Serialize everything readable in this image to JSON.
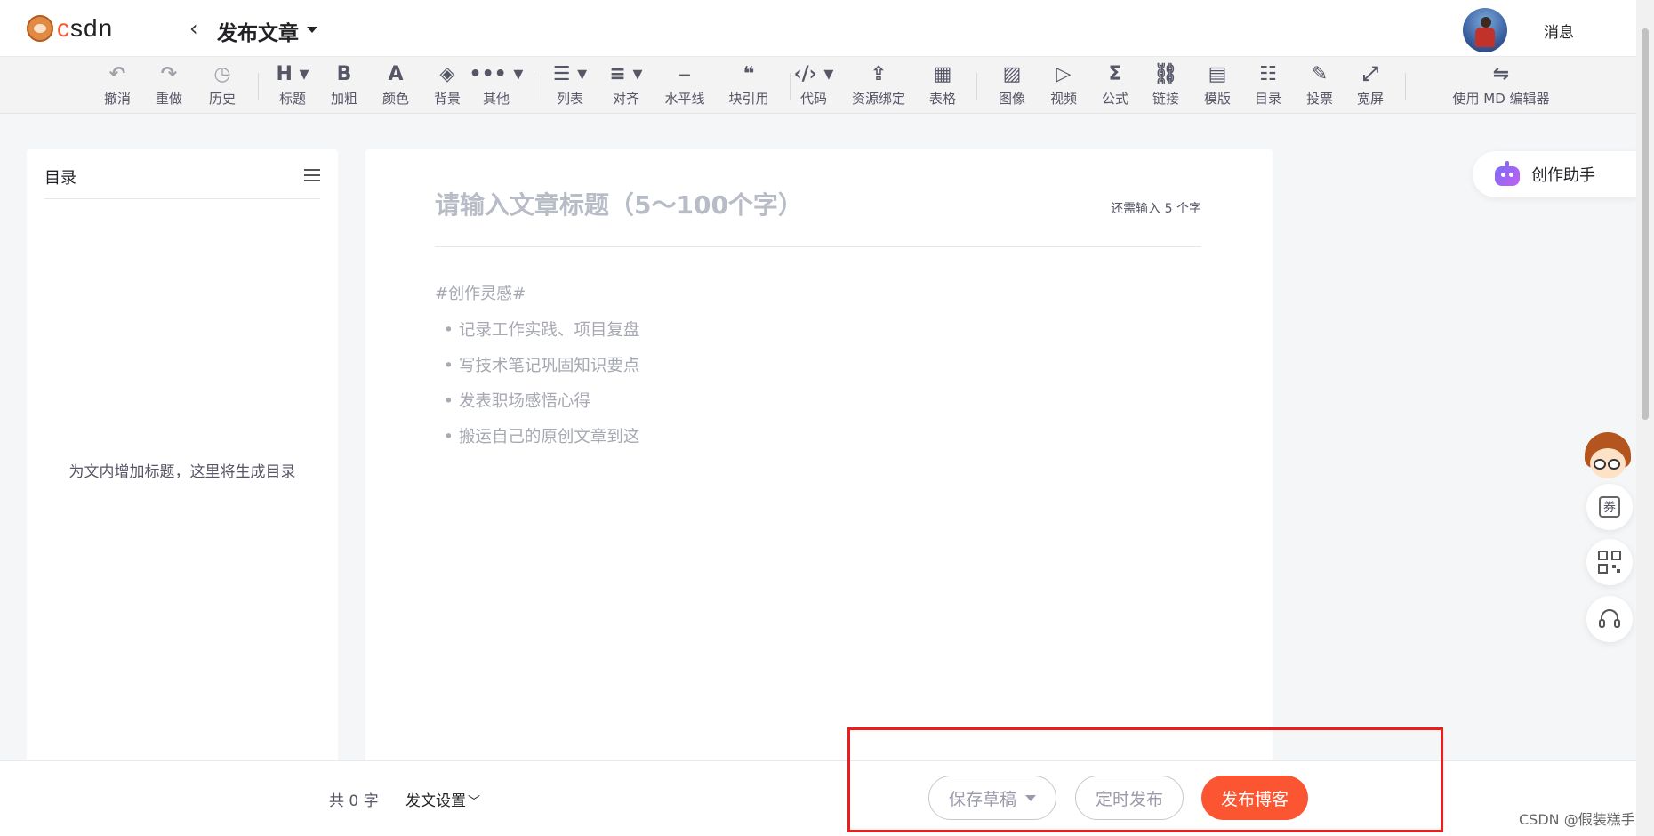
{
  "header": {
    "logo_text": "csdn",
    "back_icon": "chevron-left-icon",
    "title": "发布文章",
    "messages": "消息"
  },
  "toolbar": {
    "items": [
      {
        "icon": "↶",
        "label": "撤消",
        "name": "undo"
      },
      {
        "icon": "↷",
        "label": "重做",
        "name": "redo"
      },
      {
        "icon": "◷",
        "label": "历史",
        "name": "history"
      },
      {
        "icon": "H ▾",
        "label": "标题",
        "name": "heading"
      },
      {
        "icon": "B",
        "label": "加粗",
        "name": "bold"
      },
      {
        "icon": "A",
        "label": "颜色",
        "name": "color"
      },
      {
        "icon": "◈",
        "label": "背景",
        "name": "background"
      },
      {
        "icon": "••• ▾",
        "label": "其他",
        "name": "other"
      },
      {
        "icon": "☰ ▾",
        "label": "列表",
        "name": "list"
      },
      {
        "icon": "≡ ▾",
        "label": "对齐",
        "name": "align"
      },
      {
        "icon": "⎯",
        "label": "水平线",
        "name": "horizontal-rule"
      },
      {
        "icon": "❝",
        "label": "块引用",
        "name": "blockquote"
      },
      {
        "icon": "‹/› ▾",
        "label": "代码",
        "name": "code"
      },
      {
        "icon": "⇪",
        "label": "资源绑定",
        "name": "resource"
      },
      {
        "icon": "▦",
        "label": "表格",
        "name": "table"
      },
      {
        "icon": "▨",
        "label": "图像",
        "name": "image"
      },
      {
        "icon": "▷",
        "label": "视频",
        "name": "video"
      },
      {
        "icon": "Σ",
        "label": "公式",
        "name": "formula"
      },
      {
        "icon": "⛓",
        "label": "链接",
        "name": "link"
      },
      {
        "icon": "▤",
        "label": "模版",
        "name": "template"
      },
      {
        "icon": "☷",
        "label": "目录",
        "name": "toc"
      },
      {
        "icon": "✎",
        "label": "投票",
        "name": "vote"
      },
      {
        "icon": "⤢",
        "label": "宽屏",
        "name": "widescreen"
      },
      {
        "icon": "⇋",
        "label": "使用 MD 编辑器",
        "name": "md-editor"
      }
    ]
  },
  "toc": {
    "title": "目录",
    "empty_hint": "为文内增加标题，这里将生成目录"
  },
  "editor": {
    "title_placeholder": "请输入文章标题（5～100个字）",
    "title_hint": "还需输入 5 个字",
    "inspire_tag": "#创作灵感#",
    "suggestions": [
      "记录工作实践、项目复盘",
      "写技术笔记巩固知识要点",
      "发表职场感悟心得",
      "搬运自己的原创文章到这"
    ]
  },
  "side": {
    "assistant": "创作助手",
    "coupon": "券",
    "qr_icon": "qrcode-icon",
    "support_icon": "headset-icon"
  },
  "bottom": {
    "word_count": "共 0 字",
    "post_settings": "发文设置",
    "save_draft": "保存草稿",
    "schedule": "定时发布",
    "publish": "发布博客"
  },
  "watermark": "CSDN @假装糕手",
  "colors": {
    "brand": "#fc5531",
    "highlight": "#ee1c1c"
  }
}
